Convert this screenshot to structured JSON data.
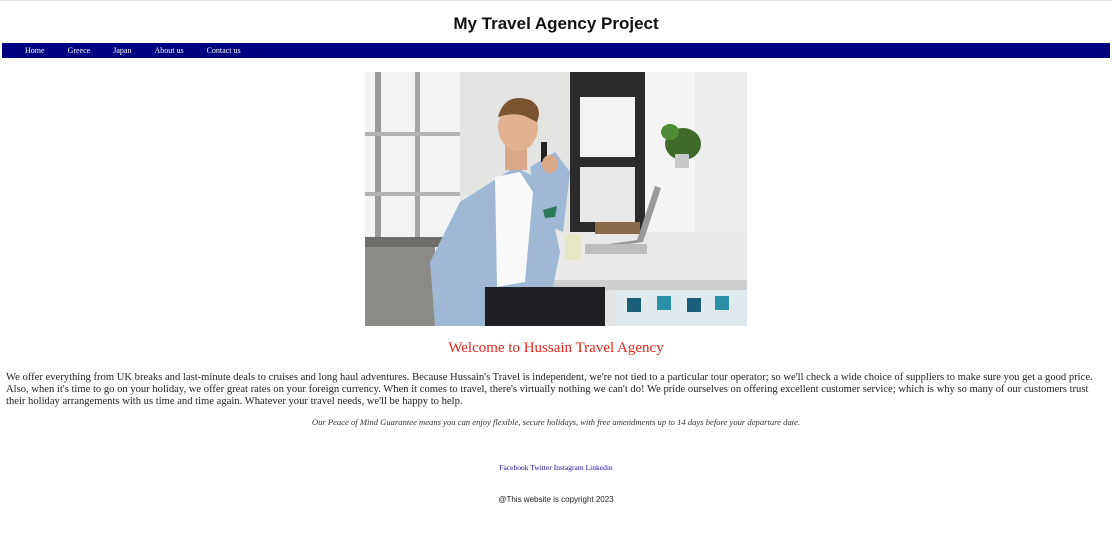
{
  "site": {
    "title": "My Travel Agency Project"
  },
  "nav": {
    "items": [
      {
        "label": "Home"
      },
      {
        "label": "Greece"
      },
      {
        "label": "Japan"
      },
      {
        "label": "About us"
      },
      {
        "label": "Contact us"
      }
    ]
  },
  "hero": {
    "icon": "man-on-phone-photo"
  },
  "main": {
    "welcome": "Welcome to Hussain Travel Agency",
    "intro": "We offer everything from UK breaks and last-minute deals to cruises and long haul adventures. Because Hussain's Travel is independent, we're not tied to a particular tour operator; so we'll check a wide choice of suppliers to make sure you get a good price. Also, when it's time to go on your holiday, we offer great rates on your foreign currency. When it comes to travel, there's virtually nothing we can't do! We pride ourselves on offering excellent customer service; which is why so many of our customers trust their holiday arrangements with us time and time again. Whatever your travel needs, we'll be happy to help.",
    "guarantee": "Our Peace of Mind Guarantee means you can enjoy flexible, secure holidays, with free amendments up to 14 days before your departure date."
  },
  "footer": {
    "social": [
      "Facebook",
      "Twitter",
      "Instagram",
      "Linkedin"
    ],
    "copyright": "@This website is copyright 2023"
  },
  "colors": {
    "nav_bg": "#000080",
    "welcome": "#e0281e",
    "links": "#1a0dab"
  }
}
